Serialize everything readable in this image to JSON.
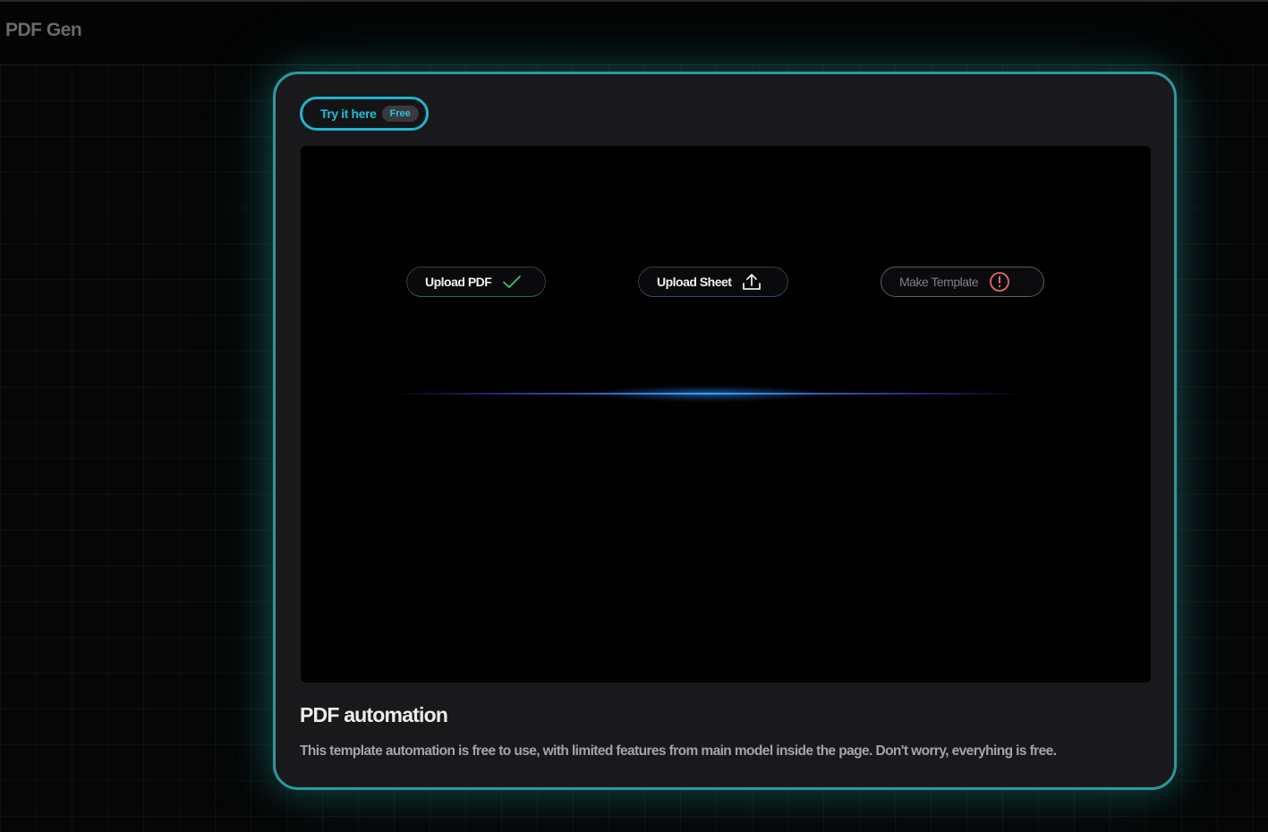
{
  "header": {
    "brand": "PDF Gen"
  },
  "card": {
    "try_label": "Try it here",
    "free_badge": "Free",
    "title": "PDF automation",
    "description": "This template automation is free to use, with limited features from main model inside the page. Don't worry, everyhing is free."
  },
  "steps": [
    {
      "label": "Upload PDF",
      "icon": "check-icon",
      "state": "done"
    },
    {
      "label": "Upload Sheet",
      "icon": "upload-icon",
      "state": "active"
    },
    {
      "label": "Make Template",
      "icon": "alert-circle-icon",
      "state": "disabled"
    }
  ],
  "colors": {
    "accent_teal": "#2a9a9c",
    "accent_cyan": "#25b9d8",
    "success_green": "#3ec46d",
    "alert_red": "#e06b6b",
    "glow_blue": "#3aa0ff"
  }
}
